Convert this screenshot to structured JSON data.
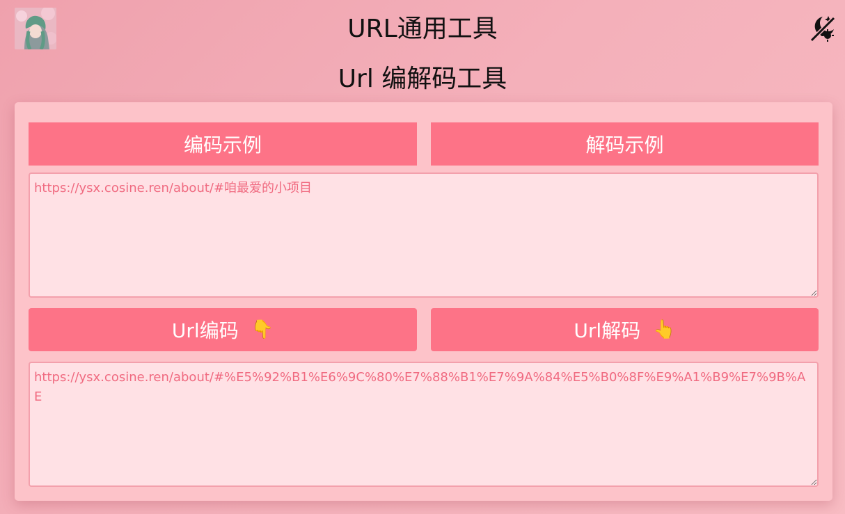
{
  "header": {
    "app_title": "URL通用工具",
    "theme_toggle_icon": "theme-toggle-moon-sun-icon"
  },
  "page": {
    "title": "Url 编解码工具"
  },
  "examples": {
    "encode_label": "编码示例",
    "decode_label": "解码示例"
  },
  "input": {
    "placeholder": "https://ysx.cosine.ren/about/#咱最爱的小项目",
    "value": ""
  },
  "actions": {
    "encode_label": "Url编码",
    "encode_emoji": "👇",
    "decode_label": "Url解码",
    "decode_emoji": "👆"
  },
  "output": {
    "placeholder": "https://ysx.cosine.ren/about/#%E5%92%B1%E6%9C%80%E7%88%B1%E7%9A%84%E5%B0%8F%E9%A1%B9%E7%9B%AE",
    "value": ""
  },
  "colors": {
    "accent": "#fd7387",
    "card_bg": "#fdc3c9",
    "textarea_bg": "#ffe1e5",
    "placeholder_text": "#f06a80"
  }
}
